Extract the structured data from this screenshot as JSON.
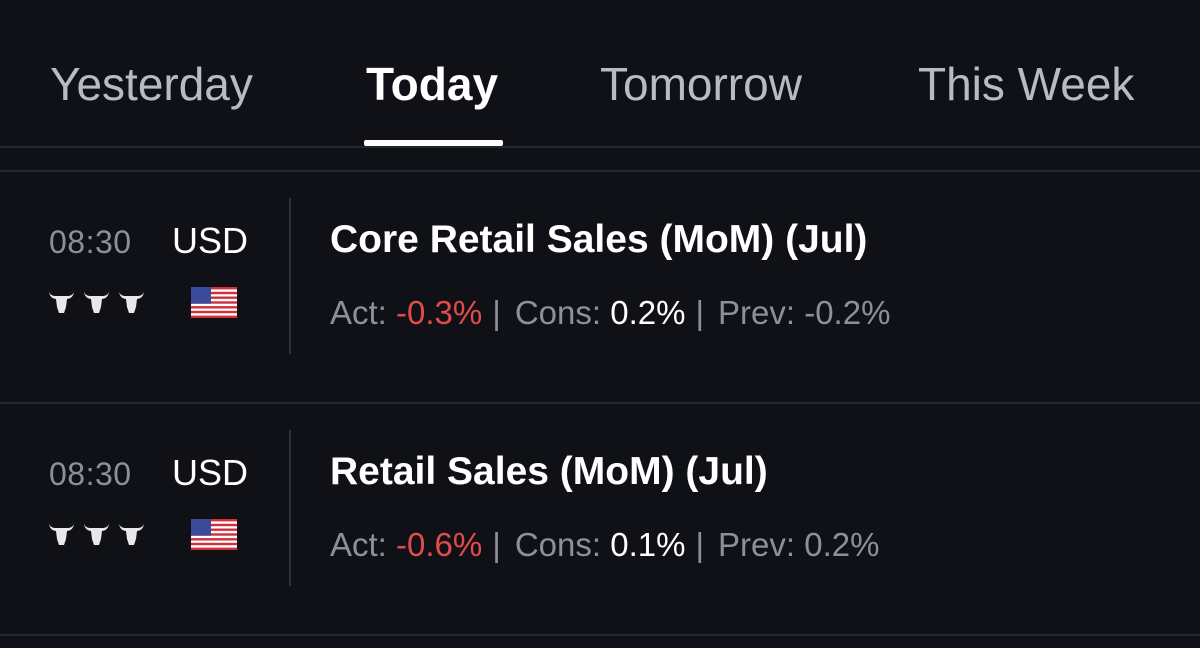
{
  "tabs": [
    {
      "label": "Yesterday",
      "active": false
    },
    {
      "label": "Today",
      "active": true
    },
    {
      "label": "Tomorrow",
      "active": false
    },
    {
      "label": "This Week",
      "active": false
    }
  ],
  "events": [
    {
      "time": "08:30",
      "currency": "USD",
      "importance": 3,
      "flag_icon": "us-flag-icon",
      "title": "Core Retail Sales (MoM) (Jul)",
      "act_label": "Act:",
      "act_value": "-0.3%",
      "cons_label": "Cons:",
      "cons_value": "0.2%",
      "prev_label": "Prev:",
      "prev_value": "-0.2%"
    },
    {
      "time": "08:30",
      "currency": "USD",
      "importance": 3,
      "flag_icon": "us-flag-icon",
      "title": "Retail Sales (MoM) (Jul)",
      "act_label": "Act:",
      "act_value": "-0.6%",
      "cons_label": "Cons:",
      "cons_value": "0.1%",
      "prev_label": "Prev:",
      "prev_value": "0.2%"
    }
  ],
  "colors": {
    "background": "#0f1117",
    "actual_negative": "#e14b4b",
    "muted_text": "#8e9097",
    "primary_text": "#ffffff"
  },
  "separator": "|"
}
